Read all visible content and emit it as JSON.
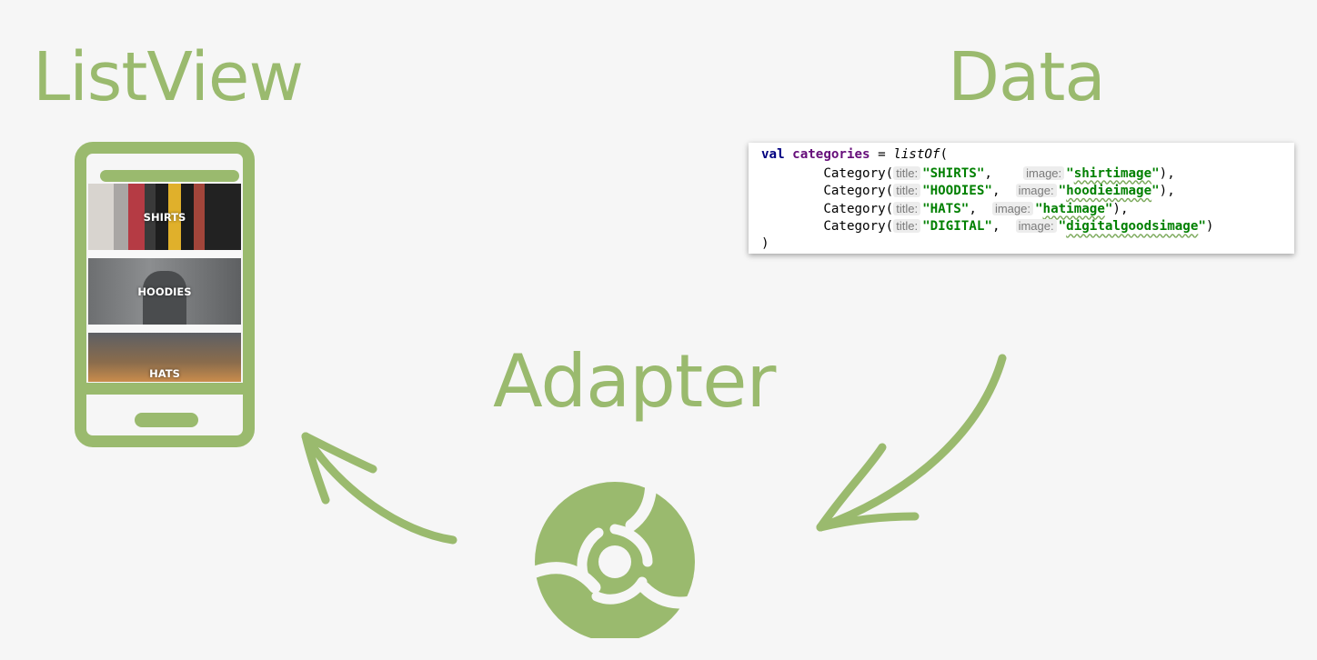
{
  "headings": {
    "listview": "ListView",
    "data": "Data",
    "adapter": "Adapter"
  },
  "phone": {
    "rows": [
      {
        "label": "SHIRTS"
      },
      {
        "label": "HOODIES"
      },
      {
        "label": "HATS"
      }
    ]
  },
  "code": {
    "line1": {
      "kw": "val",
      "name": "categories",
      "op": " = ",
      "fn": "listOf",
      "open": "("
    },
    "entries": [
      {
        "fn": "Category(",
        "title_hint": "title:",
        "title": "\"SHIRTS\"",
        "sep1": ",  ",
        "image_hint": "image:",
        "image_q1": "\"",
        "image": "shirtimage",
        "image_q2": "\"",
        "end": "),"
      },
      {
        "fn": "Category(",
        "title_hint": "title:",
        "title": "\"HOODIES\"",
        "sep1": ", ",
        "image_hint": "image:",
        "image_q1": "\"",
        "image": "hoodieimage",
        "image_q2": "\"",
        "end": "),"
      },
      {
        "fn": "Category(",
        "title_hint": "title:",
        "title": "\"HATS\"",
        "sep1": ", ",
        "image_hint": "image:",
        "image_q1": "\"",
        "image": "hatimage",
        "image_q2": "\"",
        "end": "),"
      },
      {
        "fn": "Category(",
        "title_hint": "title:",
        "title": "\"DIGITAL\"",
        "sep1": ", ",
        "image_hint": "image:",
        "image_q1": "\"",
        "image": "digitalgoodsimage",
        "image_q2": "\"",
        "end": ")"
      }
    ],
    "close": ")"
  },
  "colors": {
    "accent": "#9aba6e",
    "background": "#f6f6f6",
    "code_keyword": "#000080",
    "code_identifier": "#660e7a",
    "code_string": "#008000"
  },
  "icons": {
    "adapter": "adapter-gear-icon",
    "arrow_left": "curved-arrow-left-icon",
    "arrow_right": "curved-arrow-right-icon",
    "phone": "phone-icon"
  }
}
